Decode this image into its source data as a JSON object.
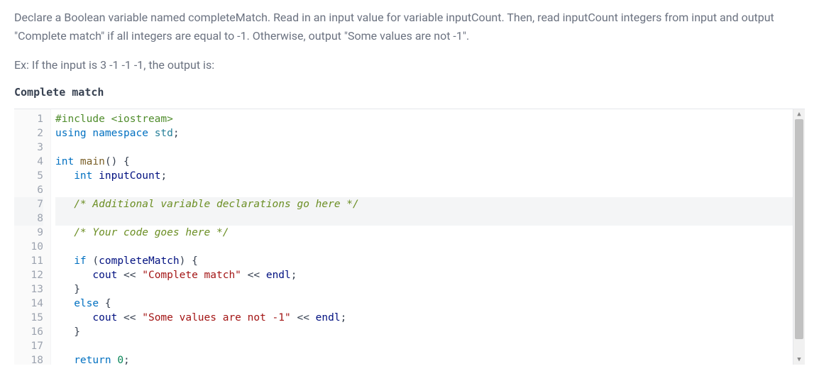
{
  "problem": {
    "para1": "Declare a Boolean variable named completeMatch. Read in an input value for variable inputCount. Then, read inputCount integers from input and output \"Complete match\" if all integers are equal to -1. Otherwise, output \"Some values are not -1\".",
    "para2": "Ex: If the input is 3 -1 -1 -1, the output is:",
    "sample_output": "Complete match"
  },
  "editor": {
    "highlighted_lines": [
      7,
      8
    ],
    "lines": [
      {
        "n": 1,
        "tokens": [
          {
            "t": "#include ",
            "c": "tok-pp"
          },
          {
            "t": "<iostream>",
            "c": "tok-pp"
          }
        ]
      },
      {
        "n": 2,
        "tokens": [
          {
            "t": "using ",
            "c": "tok-kw"
          },
          {
            "t": "namespace ",
            "c": "tok-kw"
          },
          {
            "t": "std",
            "c": "tok-ns"
          },
          {
            "t": ";",
            "c": "tok-punc"
          }
        ]
      },
      {
        "n": 3,
        "tokens": []
      },
      {
        "n": 4,
        "tokens": [
          {
            "t": "int ",
            "c": "tok-type"
          },
          {
            "t": "main",
            "c": "tok-fn"
          },
          {
            "t": "() {",
            "c": "tok-punc"
          }
        ]
      },
      {
        "n": 5,
        "tokens": [
          {
            "t": "   ",
            "c": ""
          },
          {
            "t": "int ",
            "c": "tok-type"
          },
          {
            "t": "inputCount",
            "c": "tok-var"
          },
          {
            "t": ";",
            "c": "tok-punc"
          }
        ]
      },
      {
        "n": 6,
        "tokens": []
      },
      {
        "n": 7,
        "tokens": [
          {
            "t": "   ",
            "c": ""
          },
          {
            "t": "/* Additional variable declarations go here */",
            "c": "tok-cmt"
          }
        ]
      },
      {
        "n": 8,
        "tokens": []
      },
      {
        "n": 9,
        "tokens": [
          {
            "t": "   ",
            "c": ""
          },
          {
            "t": "/* Your code goes here */",
            "c": "tok-cmt"
          }
        ]
      },
      {
        "n": 10,
        "tokens": []
      },
      {
        "n": 11,
        "tokens": [
          {
            "t": "   ",
            "c": ""
          },
          {
            "t": "if ",
            "c": "tok-kw"
          },
          {
            "t": "(",
            "c": "tok-punc"
          },
          {
            "t": "completeMatch",
            "c": "tok-var"
          },
          {
            "t": ") {",
            "c": "tok-punc"
          }
        ]
      },
      {
        "n": 12,
        "tokens": [
          {
            "t": "      ",
            "c": ""
          },
          {
            "t": "cout",
            "c": "tok-var"
          },
          {
            "t": " << ",
            "c": "tok-op"
          },
          {
            "t": "\"Complete match\"",
            "c": "tok-str"
          },
          {
            "t": " << ",
            "c": "tok-op"
          },
          {
            "t": "endl",
            "c": "tok-var"
          },
          {
            "t": ";",
            "c": "tok-punc"
          }
        ]
      },
      {
        "n": 13,
        "tokens": [
          {
            "t": "   }",
            "c": "tok-punc"
          }
        ]
      },
      {
        "n": 14,
        "tokens": [
          {
            "t": "   ",
            "c": ""
          },
          {
            "t": "else ",
            "c": "tok-kw"
          },
          {
            "t": "{",
            "c": "tok-punc"
          }
        ]
      },
      {
        "n": 15,
        "tokens": [
          {
            "t": "      ",
            "c": ""
          },
          {
            "t": "cout",
            "c": "tok-var"
          },
          {
            "t": " << ",
            "c": "tok-op"
          },
          {
            "t": "\"Some values are not -1\"",
            "c": "tok-str"
          },
          {
            "t": " << ",
            "c": "tok-op"
          },
          {
            "t": "endl",
            "c": "tok-var"
          },
          {
            "t": ";",
            "c": "tok-punc"
          }
        ]
      },
      {
        "n": 16,
        "tokens": [
          {
            "t": "   }",
            "c": "tok-punc"
          }
        ]
      },
      {
        "n": 17,
        "tokens": []
      },
      {
        "n": 18,
        "tokens": [
          {
            "t": "   ",
            "c": ""
          },
          {
            "t": "return ",
            "c": "tok-kw"
          },
          {
            "t": "0",
            "c": "tok-num"
          },
          {
            "t": ";",
            "c": "tok-punc"
          }
        ]
      }
    ]
  }
}
